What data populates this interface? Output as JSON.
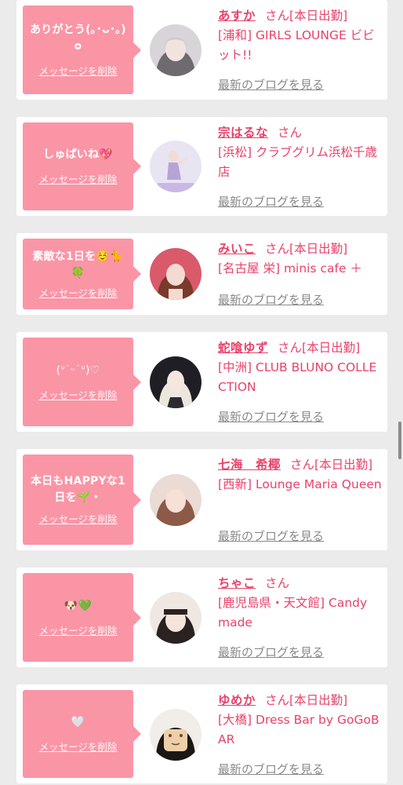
{
  "delete_label": "メッセージを削除",
  "blog_label": "最新のブログを見る",
  "accent_color": "#fa95a6",
  "name_color": "#e8426a",
  "entries": [
    {
      "message": "ありがとう(｡･ᴗ･｡)ᴑ",
      "name": "あすか",
      "honorific": "さん",
      "status": "[本日出勤]",
      "shop": "[浦和] GIRLS LOUNGE ビビット!!"
    },
    {
      "message": "しゅぱいね💖",
      "name": "宗はるな",
      "honorific": "さん",
      "status": "",
      "shop": "[浜松] クラブグリム浜松千歳店"
    },
    {
      "message": "素敵な1日を☺️🐈🍀",
      "name": "みいこ",
      "honorific": "さん",
      "status": "[本日出勤]",
      "shop": "[名古屋 栄] minis cafe ＋"
    },
    {
      "message": "(ᐡ˙ᵕ˙ᐡ)♡",
      "name": "蛇喰ゆず",
      "honorific": "さん",
      "status": "[本日出勤]",
      "shop": "[中洲] CLUB BLUNO COLLECTION"
    },
    {
      "message": "本日もHAPPYな1日を🌱・",
      "name": "七海　希椰",
      "honorific": "さん",
      "status": "[本日出勤]",
      "shop": "[西新] Lounge Maria Queen"
    },
    {
      "message": "🐶💚",
      "name": "ちゃこ",
      "honorific": "さん",
      "status": "",
      "shop": "[鹿児島県・天文館] Candy made"
    },
    {
      "message": "🤍",
      "name": "ゆめか",
      "honorific": "さん",
      "status": "[本日出勤]",
      "shop": "[大橋] Dress Bar by GoGoBAR"
    }
  ]
}
